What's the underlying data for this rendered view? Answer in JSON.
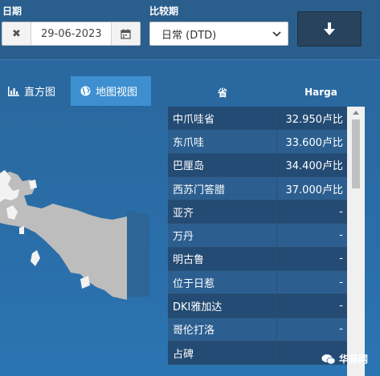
{
  "filters": {
    "date_label": "日期",
    "date_value": "29-06-2023",
    "compare_label": "比较期",
    "compare_value": "日常 (DTD)"
  },
  "tabs": [
    {
      "label": "直方图",
      "icon": "bar-chart-icon",
      "active": false
    },
    {
      "label": "地图视图",
      "icon": "globe-icon",
      "active": true
    }
  ],
  "table": {
    "col_province": "省",
    "col_price": "Harga",
    "rows": [
      {
        "province": "中爪哇省",
        "price": "32.950卢比"
      },
      {
        "province": "东爪哇",
        "price": "33.600卢比"
      },
      {
        "province": "巴厘岛",
        "price": "34.400卢比"
      },
      {
        "province": "西苏门答腊",
        "price": "37.000卢比"
      },
      {
        "province": "亚齐",
        "price": "-"
      },
      {
        "province": "万丹",
        "price": "-"
      },
      {
        "province": "明古鲁",
        "price": "-"
      },
      {
        "province": "位于日惹",
        "price": "-"
      },
      {
        "province": "DKI雅加达",
        "price": "-"
      },
      {
        "province": "哥伦打洛",
        "price": "-"
      },
      {
        "province": "占碑",
        "price": ""
      }
    ]
  },
  "watermark": {
    "text": "华蒜网"
  },
  "colors": {
    "background": "#2a6aa2",
    "active_tab": "#3d8fd0",
    "download_button": "#27435e",
    "map_land": "#bdbdbd"
  }
}
